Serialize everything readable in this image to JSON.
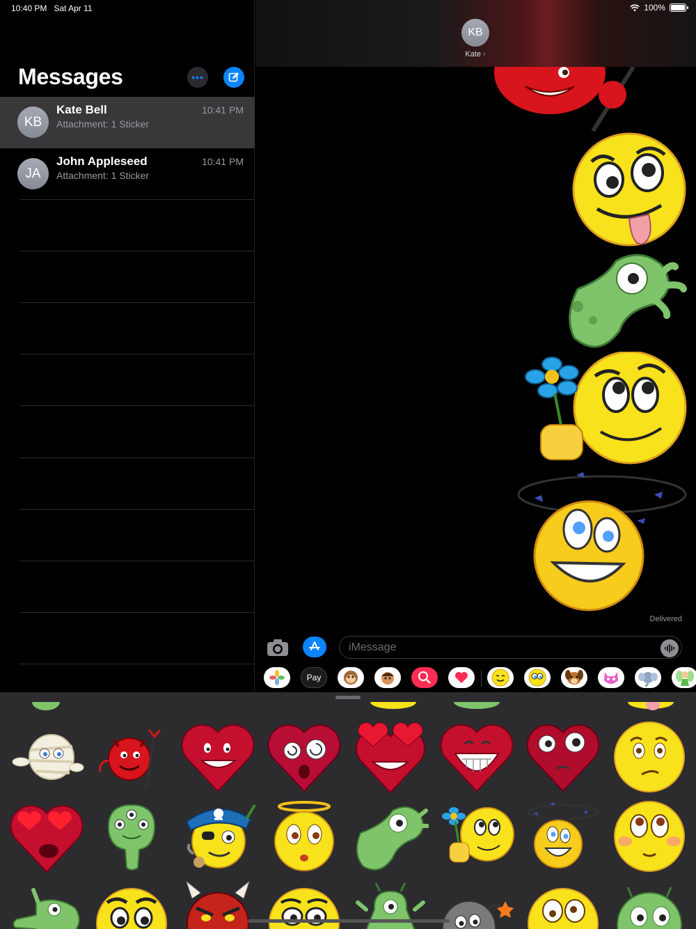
{
  "status_bar": {
    "time": "10:40 PM",
    "date": "Sat Apr 11",
    "battery": "100%"
  },
  "sidebar": {
    "title": "Messages",
    "conversations": [
      {
        "initials": "KB",
        "name": "Kate Bell",
        "preview": "Attachment: 1 Sticker",
        "time": "10:41 PM",
        "selected": true
      },
      {
        "initials": "JA",
        "name": "John Appleseed",
        "preview": "Attachment: 1 Sticker",
        "time": "10:41 PM",
        "selected": false
      }
    ]
  },
  "chat": {
    "contact_initials": "KB",
    "contact_name": "Kate",
    "status": "Delivered",
    "input_placeholder": "iMessage"
  },
  "app_strip": {
    "apple_pay_label": "Pay",
    "apps": [
      "photos-app",
      "apple-pay-app",
      "animoji-app",
      "memoji-app",
      "web-images-app",
      "digital-touch-app",
      "emoji-sticker-app",
      "eyes-sticker-app",
      "dog-sticker-app",
      "cat-sticker-app",
      "elephant-sticker-app",
      "fairy-sticker-app"
    ]
  },
  "colors": {
    "accent": "#0a84ff",
    "selected_row": "#38383a",
    "drawer_bg": "#2c2c2e",
    "sticker_yellow": "#f7e21c",
    "heart_red": "#c4102e",
    "alien_green": "#7fc46b"
  }
}
